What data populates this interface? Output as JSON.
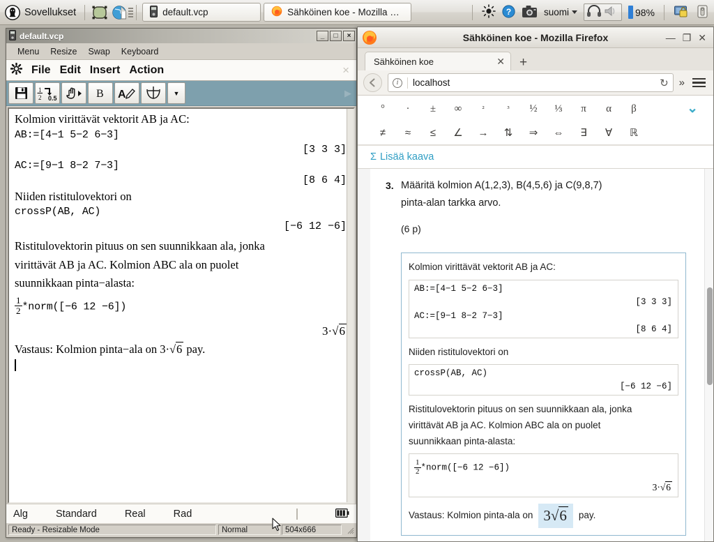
{
  "taskbar": {
    "apps_label": "Sovellukset",
    "apps_icon": "penguin-icon",
    "launchers": [
      {
        "name": "shape-selection-icon",
        "glyph": "▢"
      },
      {
        "name": "web-browser-globe-icon",
        "glyph": "ἱ0"
      }
    ],
    "windows": [
      {
        "label": "default.vcp",
        "icon": "calculator-device-icon",
        "active": false
      },
      {
        "label": "Sähköinen koe - Mozilla Fire...",
        "icon": "firefox-icon",
        "active": true
      }
    ],
    "tray": {
      "brightness_icon": "sun-brightness-icon",
      "help_icon": "help-question-icon",
      "screenshot_icon": "camera-screenshot-icon",
      "language": "suomi",
      "headphones_icon": "headphones-icon",
      "mute_icon": "speaker-mute-icon",
      "battery_percent": "98%",
      "lock_icon": "screen-lock-icon",
      "device_icon": "usb-device-icon"
    }
  },
  "cas": {
    "title": "default.vcp",
    "title_icon": "calculator-device-icon",
    "window_buttons": {
      "minimize": "_",
      "maximize": "□",
      "close": "×"
    },
    "menubar": [
      "Menu",
      "Resize",
      "Swap",
      "Keyboard"
    ],
    "appmenu": {
      "gear_icon": "gear-icon",
      "items": [
        "File",
        "Edit",
        "Insert",
        "Action"
      ],
      "close_label": "×"
    },
    "toolbar": [
      {
        "name": "save-button",
        "label": "💾"
      },
      {
        "name": "fraction-to-decimal-button",
        "label": "½→0.5"
      },
      {
        "name": "pointer-hand-button",
        "label": "☞"
      },
      {
        "name": "bold-button",
        "label": "B"
      },
      {
        "name": "text-format-button",
        "label": "A✎"
      },
      {
        "name": "graph-function-button",
        "label": "⊕"
      },
      {
        "name": "more-tools-dropdown",
        "label": "▼"
      }
    ],
    "document": {
      "line1": "Kolmion  virittävät  vektorit  AB  ja  AC:",
      "input1": "AB:=[4−1  5−2  6−3]",
      "result1": "[3  3  3]",
      "input2": "AC:=[9−1  8−2  7−3]",
      "result2": "[8  6  4]",
      "line2": "Niiden  ristitulovektori  on",
      "input3": "crossP(AB, AC)",
      "result3": "[−6  12  −6]",
      "para1_a": "Ristitulovektorin  pituus  on  sen  suunnikkaan  ala,  jonka",
      "para1_b": "virittävät  AB  ja  AC.  Kolmion  ABC  ala  on  puolet",
      "para1_c": "suunnikkaan  pinta−alasta:",
      "input4_num": "1",
      "input4_den": "2",
      "input4_rest": "*norm([−6  12  −6])",
      "result4_coef": "3·",
      "result4_radicand": "6",
      "answer_pre": "Vastaus:  Kolmion  pinta−ala  on  ",
      "answer_coef": "3·",
      "answer_radicand": "6",
      "answer_post": "  pay."
    },
    "statusline": [
      "Alg",
      "Standard",
      "Real",
      "Rad"
    ],
    "statusline_battery_icon": "battery-icon",
    "statusbar": {
      "state": "Ready - Resizable Mode",
      "mode": "Normal",
      "size": "504x666"
    }
  },
  "firefox": {
    "title": "Sähköinen koe - Mozilla Firefox",
    "logo_icon": "firefox-logo-icon",
    "window_buttons": {
      "minimize": "—",
      "maximize": "❐",
      "close": "✕"
    },
    "tab": {
      "label": "Sähköinen koe",
      "close_label": "✕"
    },
    "new_tab_label": "+",
    "nav": {
      "back_icon": "back-arrow-icon",
      "url": "localhost",
      "info_icon": "site-info-icon",
      "reload_label": "↻",
      "overflow_label": "»",
      "menu_icon": "hamburger-menu-icon"
    },
    "symbolbar": {
      "row1": [
        "°",
        "·",
        "±",
        "∞",
        "²",
        "³",
        "½",
        "⅓",
        "π",
        "α",
        "β"
      ],
      "row2": [
        "≠",
        "≈",
        "≤",
        "∠",
        "→",
        "⇅",
        "⇒",
        "⇔",
        "∃",
        "∀",
        "ℝ"
      ],
      "expand_icon": "chevron-down-icon"
    },
    "formula_link": {
      "sigma": "Σ",
      "label": "Lisää kaava"
    },
    "exam": {
      "question_number": "3.",
      "question_line1": "Määritä kolmion A(1,2,3), B(4,5,6) ja C(9,8,7)",
      "question_line2": "pinta-alan tarkka arvo.",
      "points": "(6 p)",
      "answer": {
        "text1": "Kolmion virittävät vektorit AB ja AC:",
        "calc1_in1": "AB:=[4−1  5−2  6−3]",
        "calc1_res1": "[3  3  3]",
        "calc1_in2": "AC:=[9−1  8−2  7−3]",
        "calc1_res2": "[8  6  4]",
        "text2": "Niiden ristitulovektori on",
        "calc2_in": "crossP(AB, AC)",
        "calc2_res": "[−6  12  −6]",
        "text3_a": "Ristitulovektorin pituus on sen suunnikkaan ala, jonka",
        "text3_b": "virittävät AB ja AC. Kolmion ABC ala on puolet",
        "text3_c": "suunnikkaan pinta-alasta:",
        "calc3_num": "1",
        "calc3_den": "2",
        "calc3_rest": "*norm([−6  12  −6])",
        "calc3_res_coef": "3·",
        "calc3_res_radicand": "6",
        "final_pre": "Vastaus: Kolmion pinta-ala on",
        "final_coef": "3",
        "final_radicand": "6",
        "final_post": "pay."
      }
    }
  },
  "colors": {
    "accent_blue": "#2f9ec4",
    "toolbar_teal": "#7ea0ad",
    "highlight": "#d6e9f5",
    "answer_border": "#8fb8cf"
  }
}
